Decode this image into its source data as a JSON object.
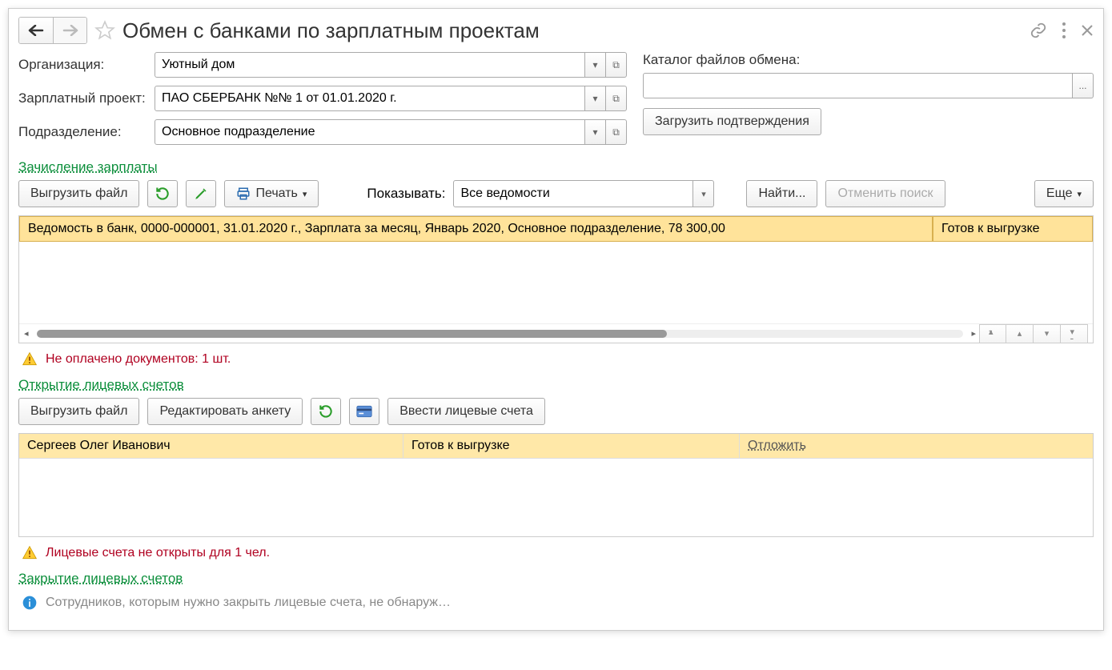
{
  "title": "Обмен с банками по зарплатным проектам",
  "form": {
    "org_label": "Организация:",
    "org_value": "Уютный дом",
    "project_label": "Зарплатный проект:",
    "project_value": "ПАО СБЕРБАНК №№ 1 от 01.01.2020 г.",
    "dept_label": "Подразделение:",
    "dept_value": "Основное подразделение",
    "exchange_dir_label": "Каталог файлов обмена:",
    "exchange_dir_value": "",
    "load_confirm_btn": "Загрузить подтверждения",
    "ellipsis_btn": "..."
  },
  "section1": {
    "link": "Зачисление зарплаты",
    "export_btn": "Выгрузить файл",
    "print_btn": "Печать",
    "show_label": "Показывать:",
    "show_value": "Все ведомости",
    "find_btn": "Найти...",
    "cancel_find_btn": "Отменить поиск",
    "more_btn": "Еще",
    "row": {
      "text": "Ведомость в банк, 0000-000001, 31.01.2020 г., Зарплата за месяц, Январь 2020, Основное подразделение, 78 300,00",
      "status": "Готов к выгрузке"
    },
    "warning": "Не оплачено документов: 1 шт."
  },
  "section2": {
    "link": "Открытие лицевых счетов",
    "export_btn": "Выгрузить файл",
    "edit_form_btn": "Редактировать анкету",
    "enter_accounts_btn": "Ввести лицевые счета",
    "row": {
      "name": "Сергеев Олег Иванович",
      "status": "Готов к выгрузке",
      "action": "Отложить"
    },
    "warning": "Лицевые счета не открыты для 1 чел."
  },
  "section3": {
    "link": "Закрытие лицевых счетов",
    "info": "Сотрудников, которым нужно закрыть лицевые счета, не обнаруж…"
  }
}
